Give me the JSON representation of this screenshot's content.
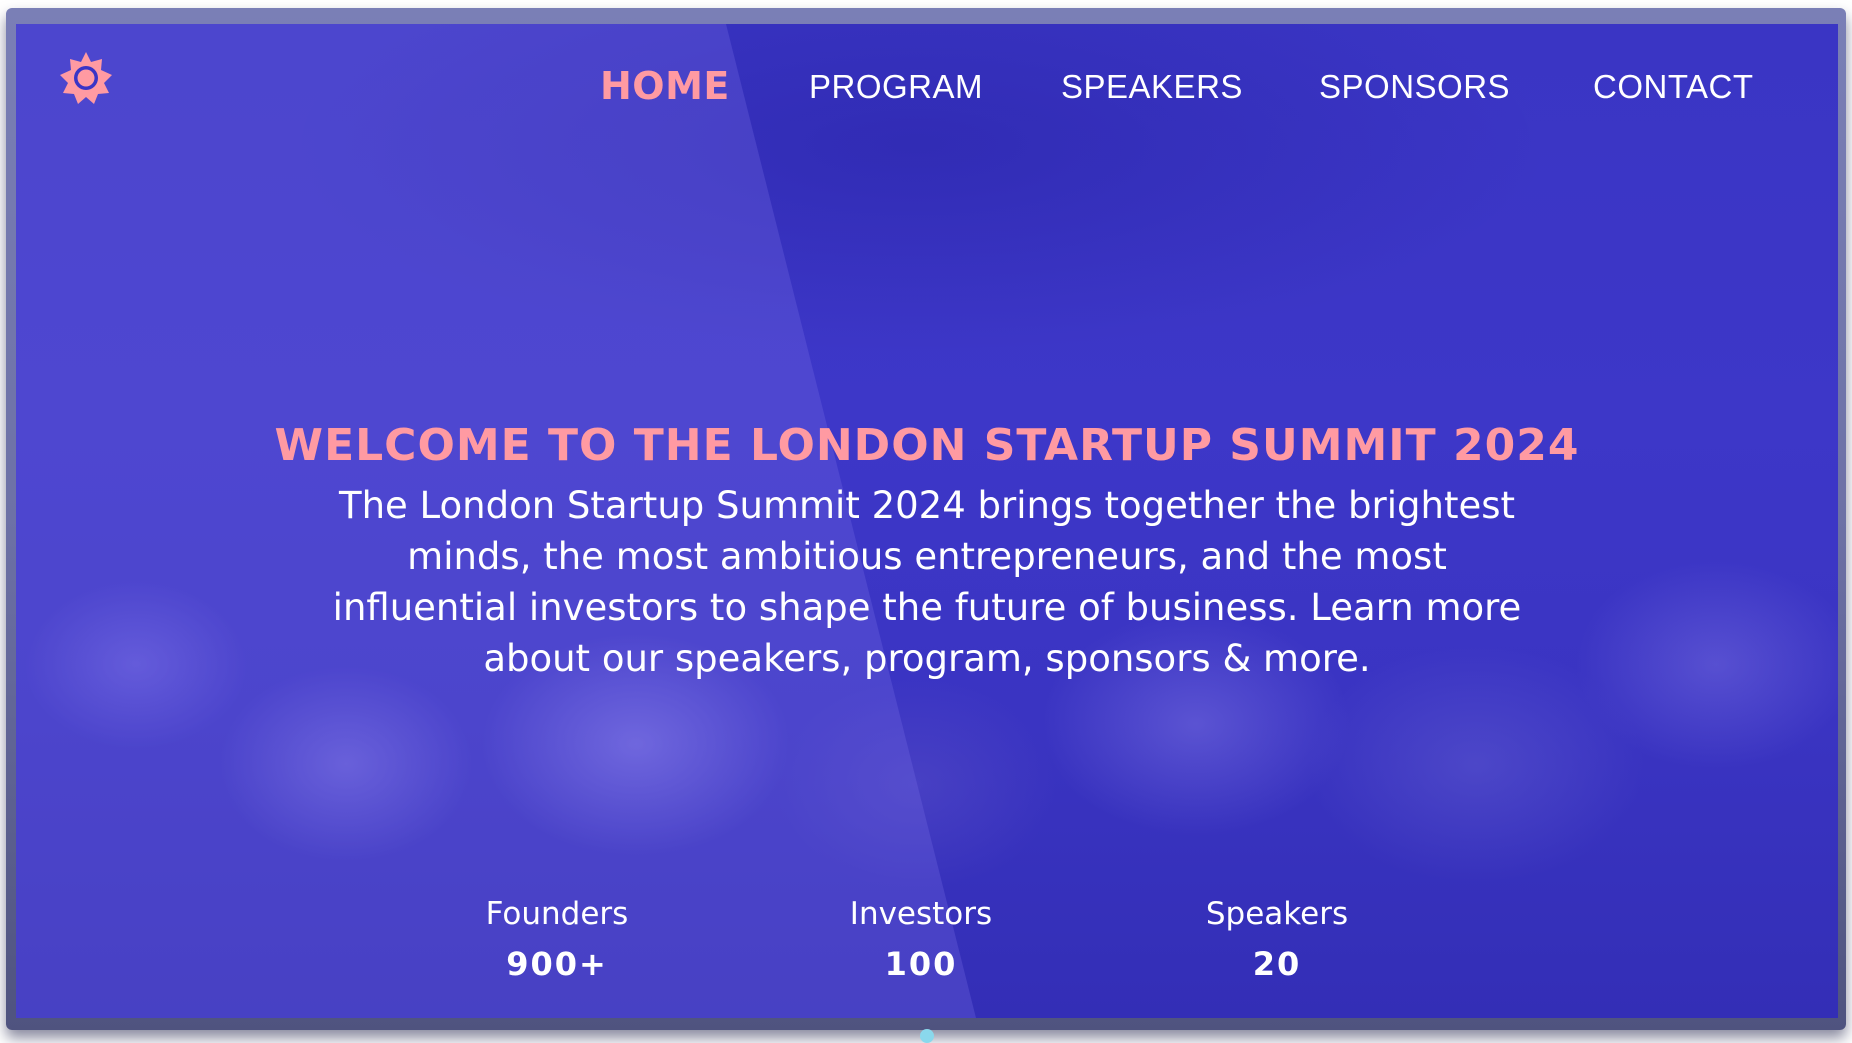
{
  "nav": {
    "logo_icon": "sun-gear-icon",
    "items": [
      {
        "label": "HOME",
        "active": true
      },
      {
        "label": "PROGRAM",
        "active": false
      },
      {
        "label": "SPEAKERS",
        "active": false
      },
      {
        "label": "SPONSORS",
        "active": false
      },
      {
        "label": "CONTACT",
        "active": false
      }
    ]
  },
  "hero": {
    "title": "WELCOME TO THE LONDON STARTUP SUMMIT 2024",
    "description": "The London Startup Summit 2024 brings together the brightest minds, the most ambitious entrepreneurs, and the most influential investors to shape the future of business. Learn more about our speakers, program, sponsors & more."
  },
  "stats": [
    {
      "label": "Founders",
      "value": "900+"
    },
    {
      "label": "Investors",
      "value": "100"
    },
    {
      "label": "Speakers",
      "value": "20"
    }
  ],
  "colors": {
    "accent": "#ff9aa2",
    "background": "#3a34c6",
    "indicator": "#8ad8ec"
  }
}
